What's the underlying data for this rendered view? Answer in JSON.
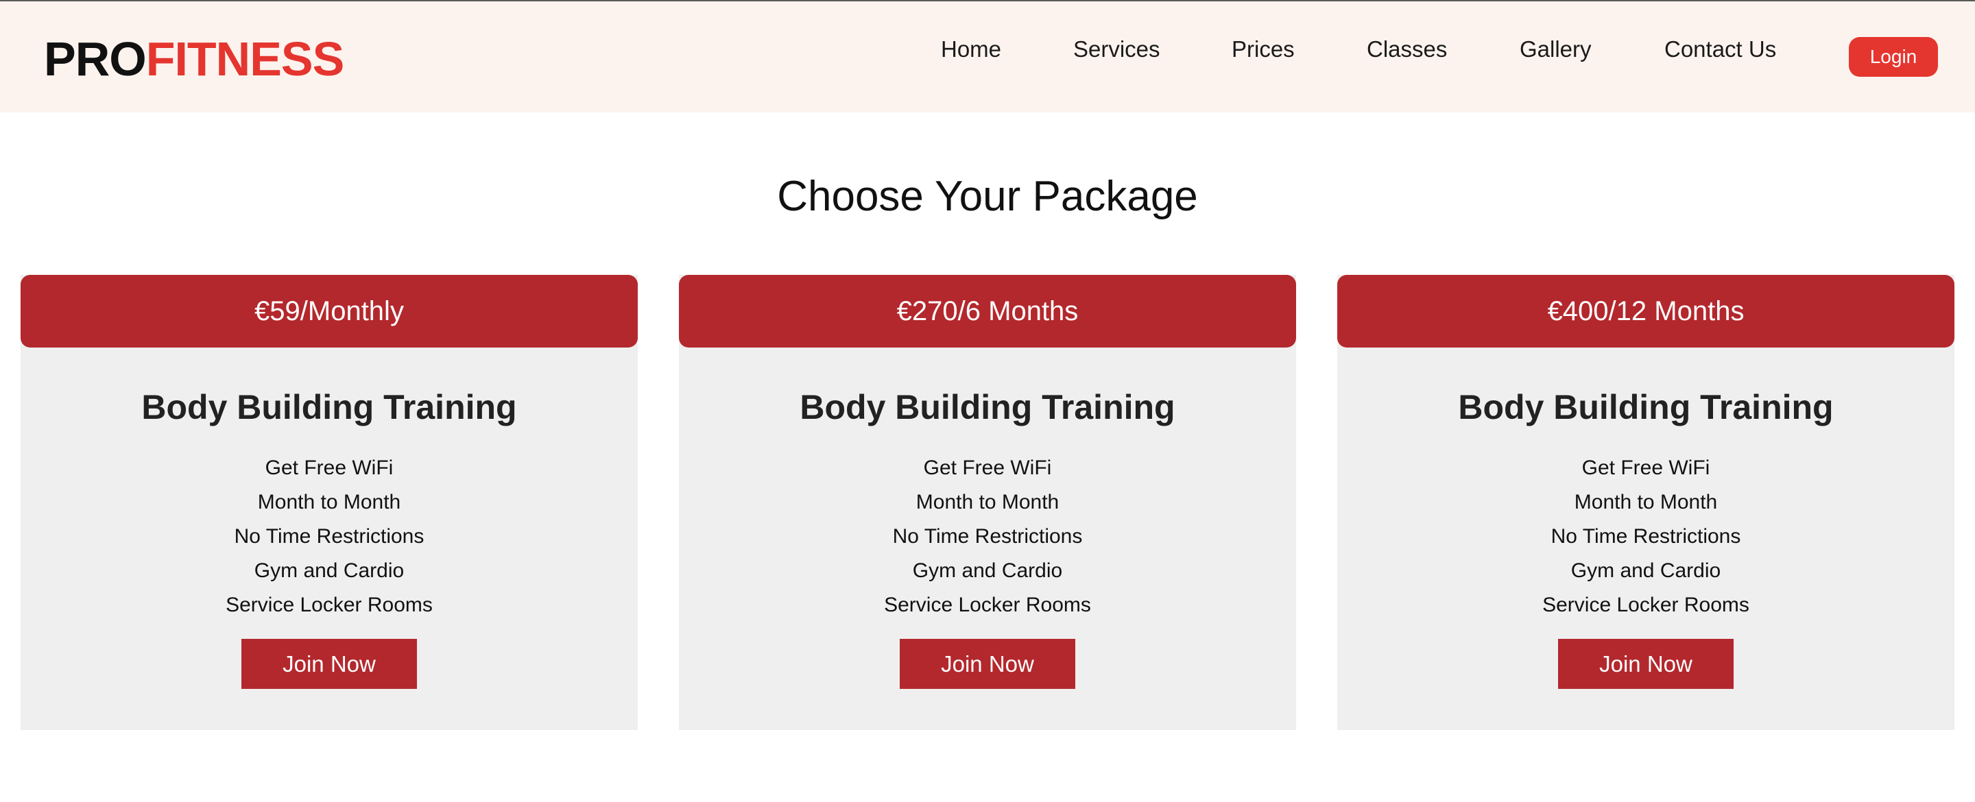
{
  "brand": {
    "logo_part1": "PRO",
    "logo_part2": "FITNESS",
    "primary_color": "#e5352f",
    "card_red": "#b3282d",
    "header_bg": "#fdf3ee"
  },
  "nav": {
    "items": [
      {
        "label": "Home"
      },
      {
        "label": "Services"
      },
      {
        "label": "Prices"
      },
      {
        "label": "Classes"
      },
      {
        "label": "Gallery"
      },
      {
        "label": "Contact Us"
      }
    ],
    "login_label": "Login"
  },
  "page": {
    "title": "Choose Your Package"
  },
  "packages": [
    {
      "price": "€59/Monthly",
      "title": "Body Building Training",
      "features": [
        "Get Free WiFi",
        "Month to Month",
        "No Time Restrictions",
        "Gym and Cardio",
        "Service Locker Rooms"
      ],
      "cta": "Join Now"
    },
    {
      "price": "€270/6 Months",
      "title": "Body Building Training",
      "features": [
        "Get Free WiFi",
        "Month to Month",
        "No Time Restrictions",
        "Gym and Cardio",
        "Service Locker Rooms"
      ],
      "cta": "Join Now"
    },
    {
      "price": "€400/12 Months",
      "title": "Body Building Training",
      "features": [
        "Get Free WiFi",
        "Month to Month",
        "No Time Restrictions",
        "Gym and Cardio",
        "Service Locker Rooms"
      ],
      "cta": "Join Now"
    }
  ]
}
